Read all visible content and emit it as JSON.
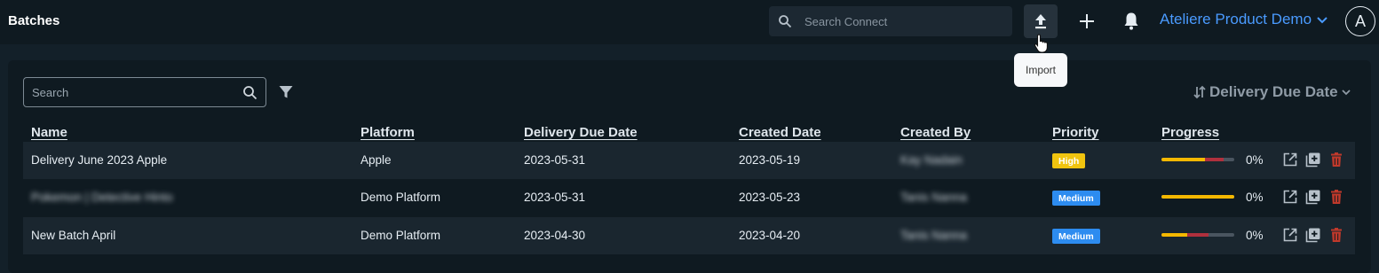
{
  "header": {
    "title": "Batches",
    "search_placeholder": "Search Connect",
    "import_tooltip": "Import",
    "workspace": "Ateliere Product Demo",
    "avatar_initial": "A"
  },
  "toolbar": {
    "search_placeholder": "Search",
    "sort_label": "Delivery Due Date"
  },
  "table": {
    "columns": [
      "Name",
      "Platform",
      "Delivery Due Date",
      "Created Date",
      "Created By",
      "Priority",
      "Progress"
    ],
    "rows": [
      {
        "name": "Delivery June 2023 Apple",
        "platform": "Apple",
        "delivery_due": "2023-05-31",
        "created": "2023-05-19",
        "created_by": "Kay Nadain",
        "priority": "High",
        "progress_pct": "0%",
        "progress_yellow": 0.6,
        "progress_red": 0.25
      },
      {
        "name": "Pokemon | Detective Hinto",
        "platform": "Demo Platform",
        "delivery_due": "2023-05-31",
        "created": "2023-05-23",
        "created_by": "Tanis Nanna",
        "priority": "Medium",
        "progress_pct": "0%",
        "progress_yellow": 1.0,
        "progress_red": 0
      },
      {
        "name": "New Batch April",
        "platform": "Demo Platform",
        "delivery_due": "2023-04-30",
        "created": "2023-04-20",
        "created_by": "Tanis Nanna",
        "priority": "Medium",
        "progress_pct": "0%",
        "progress_yellow": 0.35,
        "progress_red": 0.3
      }
    ]
  },
  "colors": {
    "accent": "#4a9bff",
    "high": "#f1c40f",
    "medium": "#2d8cf0",
    "progress_yellow": "#f5b800",
    "progress_red": "#b0303d",
    "delete": "#c0392b"
  }
}
